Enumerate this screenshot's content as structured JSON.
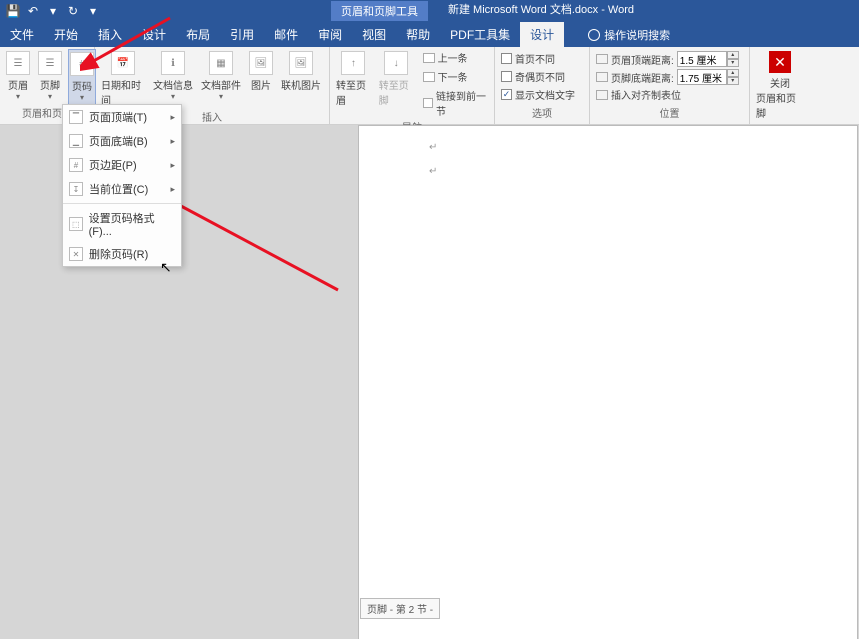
{
  "title_tool_tab": "页眉和页脚工具",
  "doc_title": "新建 Microsoft Word 文档.docx - Word",
  "tabs": [
    "文件",
    "开始",
    "插入",
    "设计",
    "布局",
    "引用",
    "邮件",
    "审阅",
    "视图",
    "帮助",
    "PDF工具集",
    "设计"
  ],
  "tell_me": "操作说明搜索",
  "ribbon": {
    "hf": {
      "header": "页眉",
      "footer": "页脚",
      "pagenum": "页码",
      "label": "页眉和页脚"
    },
    "insert": {
      "datetime": "日期和时间",
      "docinfo": "文档信息",
      "docparts": "文档部件",
      "pic": "图片",
      "onlinepic": "联机图片",
      "label": "插入"
    },
    "nav": {
      "goto_header": "转至页眉",
      "goto_footer": "转至页脚",
      "prev": "上一条",
      "next": "下一条",
      "link": "链接到前一节",
      "label": "导航"
    },
    "options": {
      "diff_first": "首页不同",
      "diff_odd": "奇偶页不同",
      "show_text": "显示文档文字",
      "label": "选项"
    },
    "position": {
      "header_dist": "页眉顶端距离:",
      "footer_dist": "页脚底端距离:",
      "header_val": "1.5 厘米",
      "footer_val": "1.75 厘米",
      "align_tab": "插入对齐制表位",
      "label": "位置"
    },
    "close": {
      "main": "关闭",
      "sub": "页眉和页脚",
      "label": "关闭"
    }
  },
  "menu": {
    "top": "页面顶端(T)",
    "bottom": "页面底端(B)",
    "margin": "页边距(P)",
    "current": "当前位置(C)",
    "format": "设置页码格式(F)...",
    "remove": "删除页码(R)"
  },
  "footer_section": "页脚 - 第 2 节 -"
}
